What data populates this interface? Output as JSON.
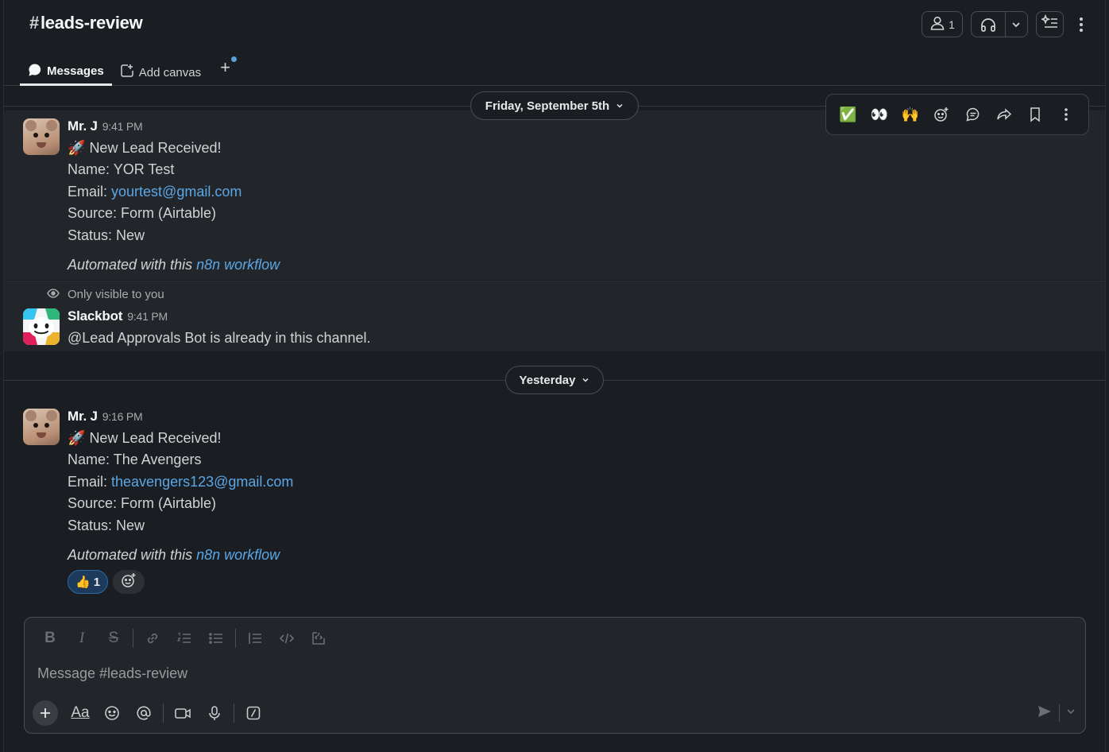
{
  "channel": {
    "hash": "#",
    "name": "leads-review"
  },
  "header": {
    "member_count": "1"
  },
  "tabs": [
    {
      "label": "Messages"
    },
    {
      "label": "Add canvas"
    }
  ],
  "dividers": {
    "first": "Friday, September 5th",
    "second": "Yesterday"
  },
  "messages": [
    {
      "author": "Mr. J",
      "time": "9:41 PM",
      "title": "New Lead Received!",
      "name_label": "Name: ",
      "name_value": "YOR Test",
      "email_label": "Email: ",
      "email_value": "yourtest@gmail.com",
      "source": "Source: Form (Airtable)",
      "status": "Status: New",
      "automated_prefix": "Automated with this ",
      "automated_link": "n8n workflow"
    },
    {
      "visibility_note": "Only visible to you",
      "author": "Slackbot",
      "time": "9:41 PM",
      "text": "@Lead Approvals Bot is already in this channel."
    },
    {
      "author": "Mr. J",
      "time": "9:16 PM",
      "title": "New Lead Received!",
      "name_label": "Name: ",
      "name_value": "The Avengers",
      "email_label": "Email: ",
      "email_value": "theavengers123@gmail.com",
      "source": "Source: Form (Airtable)",
      "status": "Status: New",
      "automated_prefix": "Automated with this ",
      "automated_link": "n8n workflow",
      "reaction": {
        "emoji": "👍",
        "count": "1"
      }
    }
  ],
  "hover_actions": {
    "quick_reactions": [
      "✅",
      "👀",
      "🙌"
    ]
  },
  "composer": {
    "placeholder": "Message #leads-review"
  },
  "colors": {
    "background": "#1a1d21",
    "link": "#5aa7e6",
    "reaction_bg": "#1d3a5c"
  }
}
